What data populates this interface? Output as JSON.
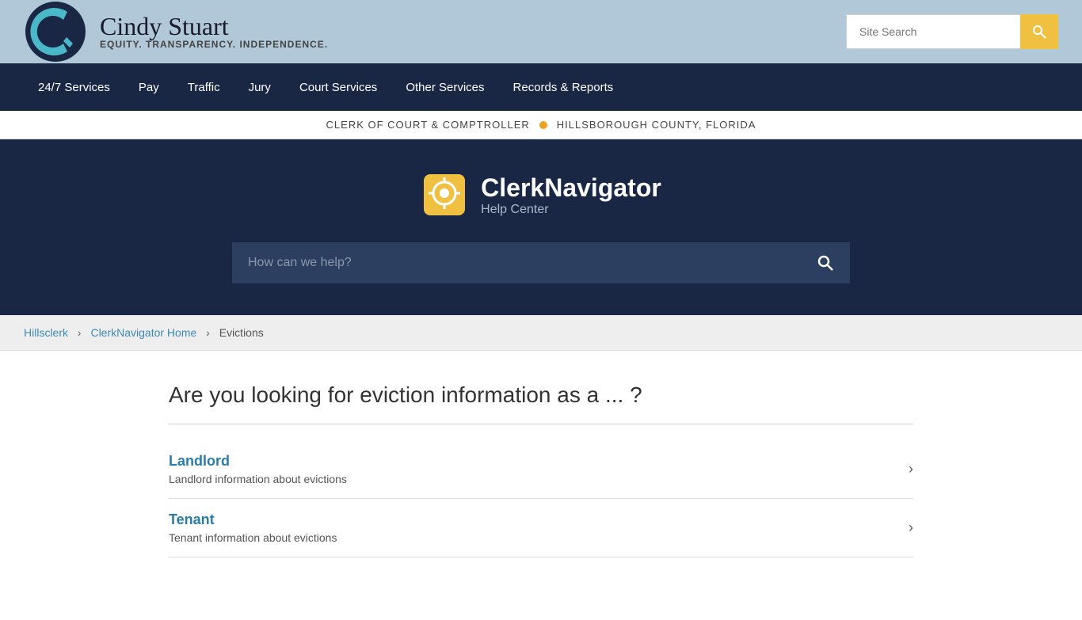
{
  "header": {
    "brand_name": "Cindy Stuart",
    "tagline": "EQUITY. TRANSPARENCY. INDEPENDENCE.",
    "search_placeholder": "Site Search"
  },
  "nav": {
    "items": [
      {
        "label": "24/7 Services",
        "id": "nav-247"
      },
      {
        "label": "Pay",
        "id": "nav-pay"
      },
      {
        "label": "Traffic",
        "id": "nav-traffic"
      },
      {
        "label": "Jury",
        "id": "nav-jury"
      },
      {
        "label": "Court Services",
        "id": "nav-court"
      },
      {
        "label": "Other Services",
        "id": "nav-other"
      },
      {
        "label": "Records & Reports",
        "id": "nav-records"
      }
    ]
  },
  "sub_header": {
    "left": "CLERK OF COURT & COMPTROLLER",
    "right": "HILLSBOROUGH COUNTY, FLORIDA"
  },
  "hero": {
    "brand_name": "ClerkNavigator",
    "brand_sub": "Help Center",
    "search_placeholder": "How can we help?"
  },
  "breadcrumb": {
    "items": [
      {
        "label": "Hillsclerk",
        "link": true
      },
      {
        "label": "ClerkNavigator Home",
        "link": true
      },
      {
        "label": "Evictions",
        "link": false
      }
    ]
  },
  "main": {
    "question": "Are you looking for eviction information as a ... ?",
    "options": [
      {
        "title": "Landlord",
        "description": "Landlord information about evictions"
      },
      {
        "title": "Tenant",
        "description": "Tenant information about evictions"
      }
    ]
  }
}
